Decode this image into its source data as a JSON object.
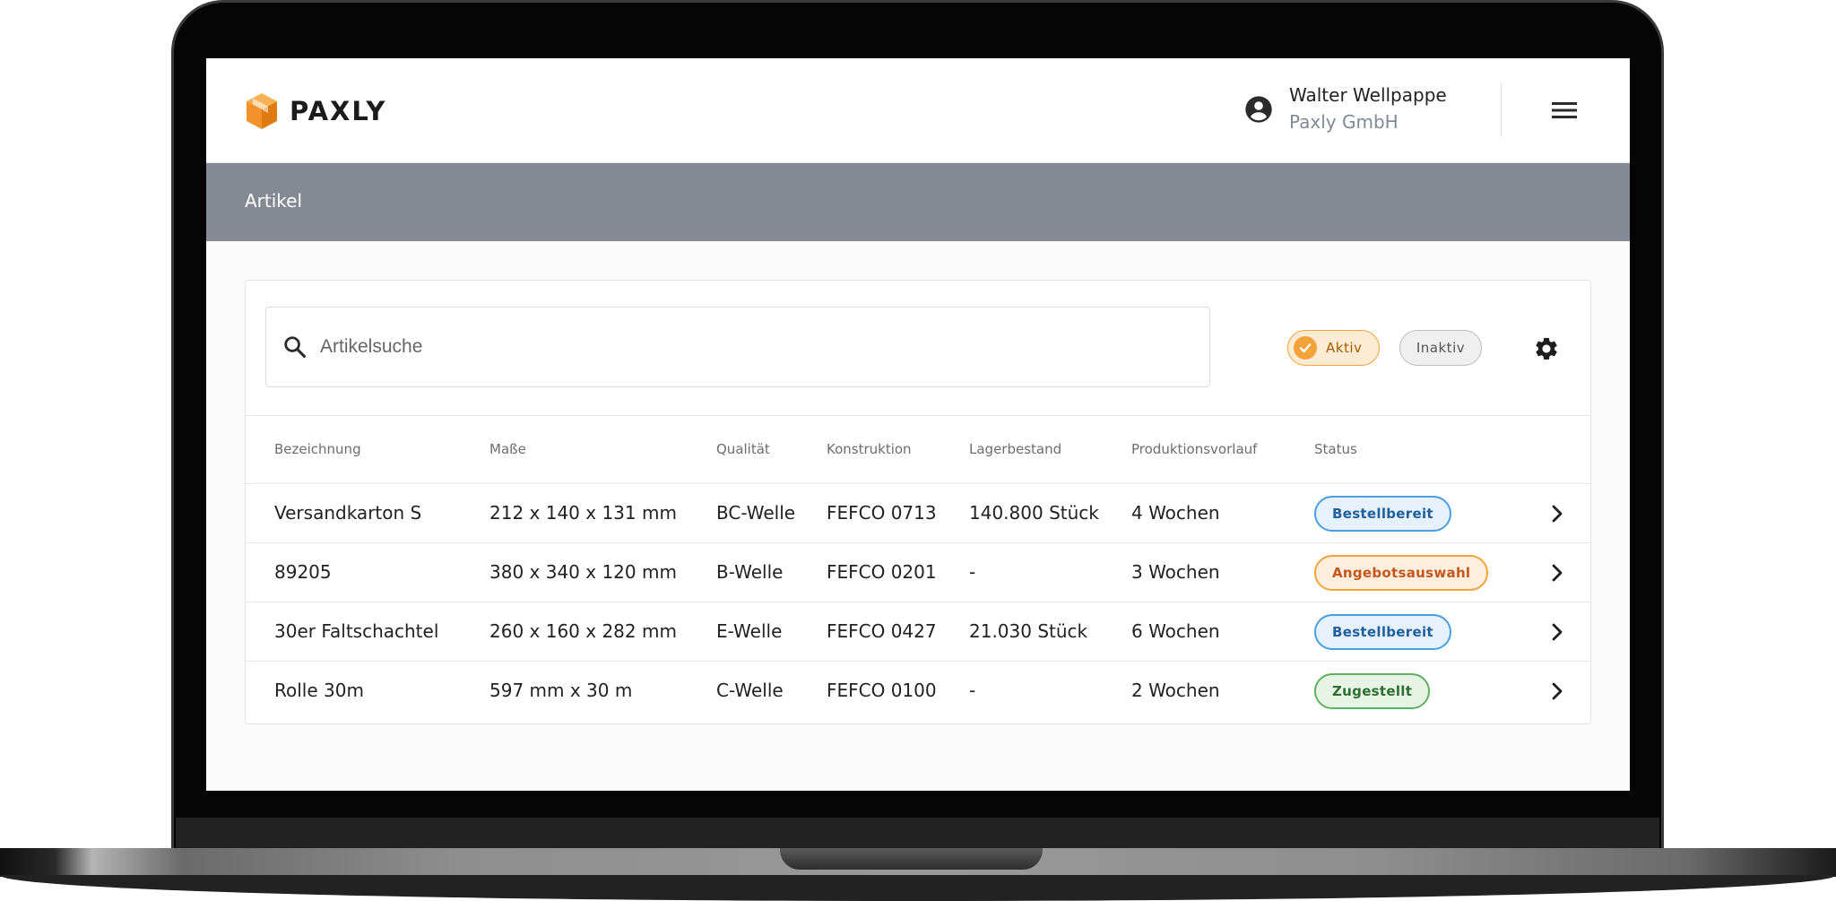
{
  "brand": {
    "name": "PAXLY",
    "accent": "#f2a33a"
  },
  "user": {
    "name": "Walter Wellpappe",
    "company": "Paxly GmbH"
  },
  "subbar": {
    "title": "Artikel"
  },
  "search": {
    "placeholder": "Artikelsuche",
    "value": ""
  },
  "filters": {
    "aktiv": {
      "label": "Aktiv",
      "selected": true
    },
    "inaktiv": {
      "label": "Inaktiv",
      "selected": false
    }
  },
  "table": {
    "headers": [
      "Bezeichnung",
      "Maße",
      "Qualität",
      "Konstruktion",
      "Lagerbestand",
      "Produktionsvorlauf",
      "Status"
    ],
    "rows": [
      {
        "name": "Versandkarton S",
        "dims": "212 x 140 x 131 mm",
        "quality": "BC-Welle",
        "construction": "FEFCO 0713",
        "stock": "140.800 Stück",
        "lead": "4 Wochen",
        "status": "Bestellbereit",
        "status_color": "blue"
      },
      {
        "name": "89205",
        "dims": "380 x 340 x 120 mm",
        "quality": "B-Welle",
        "construction": "FEFCO 0201",
        "stock": "-",
        "lead": "3 Wochen",
        "status": "Angebotsauswahl",
        "status_color": "orange"
      },
      {
        "name": "30er Faltschachtel",
        "dims": "260 x 160 x 282 mm",
        "quality": "E-Welle",
        "construction": "FEFCO 0427",
        "stock": "21.030 Stück",
        "lead": "6 Wochen",
        "status": "Bestellbereit",
        "status_color": "blue"
      },
      {
        "name": "Rolle 30m",
        "dims": "597 mm x 30 m",
        "quality": "C-Welle",
        "construction": "FEFCO 0100",
        "stock": "-",
        "lead": "2 Wochen",
        "status": "Zugestellt",
        "status_color": "green"
      }
    ]
  },
  "icons": {
    "logo": "box-logo-icon",
    "user": "account-circle-icon",
    "menu": "hamburger-menu-icon",
    "search": "search-icon",
    "check": "check-icon",
    "settings": "gear-icon",
    "row_action": "chevron-right-icon"
  }
}
